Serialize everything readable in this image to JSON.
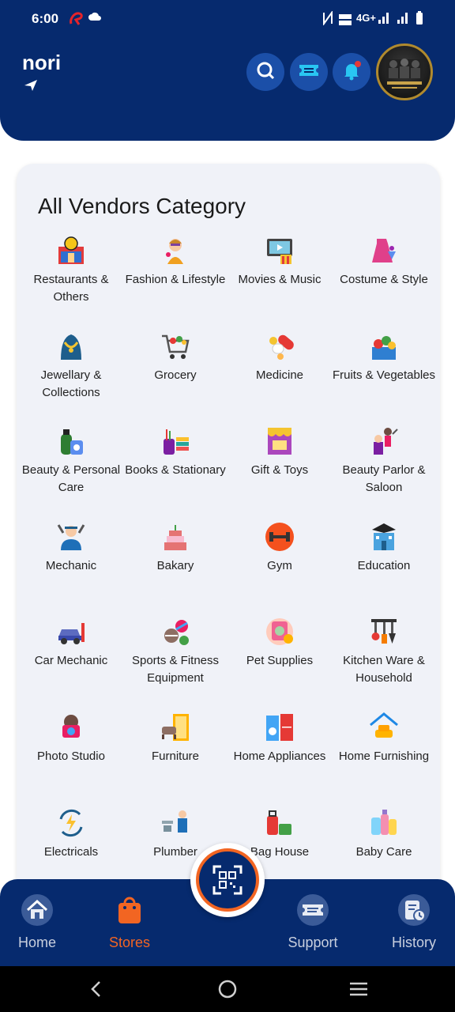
{
  "status": {
    "time": "6:00",
    "network": "4G+"
  },
  "header": {
    "brand": "nori"
  },
  "card": {
    "title": "All Vendors Category",
    "categories": [
      {
        "label": "Restaurants & Others",
        "icon": "restaurant-icon"
      },
      {
        "label": "Fashion & Lifestyle",
        "icon": "fashion-icon"
      },
      {
        "label": "Movies & Music",
        "icon": "movies-icon"
      },
      {
        "label": "Costume & Style",
        "icon": "costume-icon"
      },
      {
        "label": "Jewellary & Collections",
        "icon": "jewellery-icon"
      },
      {
        "label": "Grocery",
        "icon": "grocery-cart-icon"
      },
      {
        "label": "Medicine",
        "icon": "medicine-icon"
      },
      {
        "label": "Fruits & Vegetables",
        "icon": "fruits-icon"
      },
      {
        "label": "Beauty & Personal Care",
        "icon": "beauty-icon"
      },
      {
        "label": "Books & Stationary",
        "icon": "books-icon"
      },
      {
        "label": "Gift & Toys",
        "icon": "gift-shop-icon"
      },
      {
        "label": "Beauty Parlor & Saloon",
        "icon": "salon-icon"
      },
      {
        "label": "Mechanic",
        "icon": "mechanic-icon"
      },
      {
        "label": "Bakary",
        "icon": "cake-icon"
      },
      {
        "label": "Gym",
        "icon": "dumbbell-icon"
      },
      {
        "label": "Education",
        "icon": "school-icon"
      },
      {
        "label": "Car Mechanic",
        "icon": "car-repair-icon"
      },
      {
        "label": "Sports & Fitness Equipment",
        "icon": "sports-icon"
      },
      {
        "label": "Pet Supplies",
        "icon": "pet-icon"
      },
      {
        "label": "Kitchen Ware & Household",
        "icon": "kitchenware-icon"
      },
      {
        "label": "Photo Studio",
        "icon": "camera-icon"
      },
      {
        "label": "Furniture",
        "icon": "furniture-icon"
      },
      {
        "label": "Home Appliances",
        "icon": "appliances-icon"
      },
      {
        "label": "Home Furnishing",
        "icon": "home-furnishing-icon"
      },
      {
        "label": "Electricals",
        "icon": "electricals-icon"
      },
      {
        "label": "Plumber",
        "icon": "plumber-icon"
      },
      {
        "label": "Bag House",
        "icon": "bag-icon"
      },
      {
        "label": "Baby Care",
        "icon": "baby-care-icon"
      }
    ]
  },
  "nav": {
    "home": "Home",
    "stores": "Stores",
    "support": "Support",
    "history": "History",
    "active": "Stores"
  },
  "colors": {
    "primary": "#062a6e",
    "accent": "#f26522",
    "card_bg": "#f0f2f8"
  }
}
